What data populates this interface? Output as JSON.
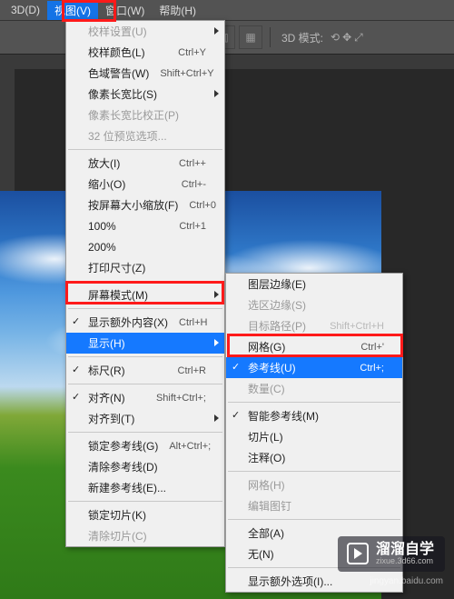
{
  "menubar": {
    "items": [
      {
        "label": "3D(D)"
      },
      {
        "label": "视图(V)",
        "active": true
      },
      {
        "label": "窗口(W)"
      },
      {
        "label": "帮助(H)"
      }
    ]
  },
  "toolbar": {
    "mode_label": "3D 模式:"
  },
  "view_menu": [
    {
      "type": "item",
      "label": "校样设置(U)",
      "submenu": true,
      "disabled": true
    },
    {
      "type": "item",
      "label": "校样颜色(L)",
      "shortcut": "Ctrl+Y"
    },
    {
      "type": "item",
      "label": "色域警告(W)",
      "shortcut": "Shift+Ctrl+Y"
    },
    {
      "type": "item",
      "label": "像素长宽比(S)",
      "submenu": true
    },
    {
      "type": "item",
      "label": "像素长宽比校正(P)",
      "disabled": true
    },
    {
      "type": "item",
      "label": "32 位预览选项...",
      "disabled": true
    },
    {
      "type": "divider"
    },
    {
      "type": "item",
      "label": "放大(I)",
      "shortcut": "Ctrl++"
    },
    {
      "type": "item",
      "label": "缩小(O)",
      "shortcut": "Ctrl+-"
    },
    {
      "type": "item",
      "label": "按屏幕大小缩放(F)",
      "shortcut": "Ctrl+0"
    },
    {
      "type": "item",
      "label": "100%",
      "shortcut": "Ctrl+1"
    },
    {
      "type": "item",
      "label": "200%"
    },
    {
      "type": "item",
      "label": "打印尺寸(Z)"
    },
    {
      "type": "divider"
    },
    {
      "type": "item",
      "label": "屏幕模式(M)",
      "submenu": true
    },
    {
      "type": "divider"
    },
    {
      "type": "item",
      "label": "显示额外内容(X)",
      "shortcut": "Ctrl+H",
      "checked": true
    },
    {
      "type": "item",
      "label": "显示(H)",
      "submenu": true,
      "highlight": true
    },
    {
      "type": "divider"
    },
    {
      "type": "item",
      "label": "标尺(R)",
      "shortcut": "Ctrl+R",
      "checked": true
    },
    {
      "type": "divider"
    },
    {
      "type": "item",
      "label": "对齐(N)",
      "shortcut": "Shift+Ctrl+;",
      "checked": true
    },
    {
      "type": "item",
      "label": "对齐到(T)",
      "submenu": true
    },
    {
      "type": "divider"
    },
    {
      "type": "item",
      "label": "锁定参考线(G)",
      "shortcut": "Alt+Ctrl+;"
    },
    {
      "type": "item",
      "label": "清除参考线(D)"
    },
    {
      "type": "item",
      "label": "新建参考线(E)..."
    },
    {
      "type": "divider"
    },
    {
      "type": "item",
      "label": "锁定切片(K)"
    },
    {
      "type": "item",
      "label": "清除切片(C)",
      "disabled": true
    }
  ],
  "show_submenu": [
    {
      "type": "item",
      "label": "图层边缘(E)"
    },
    {
      "type": "item",
      "label": "选区边缘(S)",
      "disabled": true
    },
    {
      "type": "item",
      "label": "目标路径(P)",
      "shortcut": "Shift+Ctrl+H",
      "disabled": true
    },
    {
      "type": "item",
      "label": "网格(G)",
      "shortcut": "Ctrl+'"
    },
    {
      "type": "item",
      "label": "参考线(U)",
      "shortcut": "Ctrl+;",
      "checked": true,
      "highlight": true
    },
    {
      "type": "item",
      "label": "数量(C)",
      "disabled": true
    },
    {
      "type": "divider"
    },
    {
      "type": "item",
      "label": "智能参考线(M)",
      "checked": true
    },
    {
      "type": "item",
      "label": "切片(L)"
    },
    {
      "type": "item",
      "label": "注释(O)"
    },
    {
      "type": "divider"
    },
    {
      "type": "item",
      "label": "网格(H)",
      "disabled": true
    },
    {
      "type": "item",
      "label": "编辑图钉",
      "disabled": true
    },
    {
      "type": "divider"
    },
    {
      "type": "item",
      "label": "全部(A)"
    },
    {
      "type": "item",
      "label": "无(N)"
    },
    {
      "type": "divider"
    },
    {
      "type": "item",
      "label": "显示额外选项(I)..."
    }
  ],
  "watermark": {
    "title": "溜溜自学",
    "sub": "zixue.3d66.com"
  },
  "credit": "jingyan.baidu.com"
}
